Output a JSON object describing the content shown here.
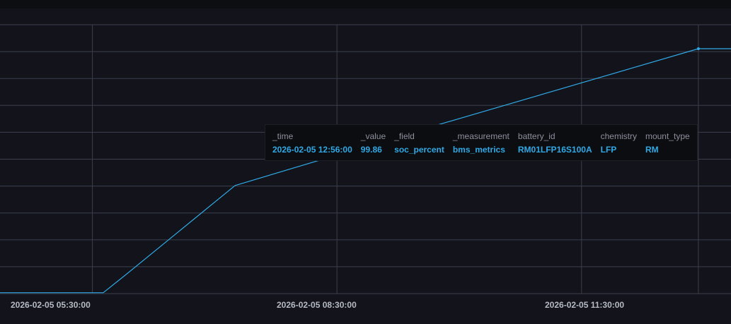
{
  "chart_data": {
    "type": "line",
    "series": [
      {
        "color": "#2fa9e6",
        "points": [
          [
            "2026-02-05 04:22:00",
            0
          ],
          [
            "2026-02-05 05:38:00",
            0
          ],
          [
            "2026-02-05 05:55:00",
            1.0
          ],
          [
            "2026-02-05 07:15:00",
            5.8
          ],
          [
            "2026-02-05 09:45:00",
            9.1
          ],
          [
            "2026-02-05 12:56:00",
            13.2
          ],
          [
            "2026-02-05 13:20:00",
            13.2
          ]
        ]
      }
    ],
    "x_range": [
      "2026-02-05 04:22:00",
      "2026-02-05 13:20:00"
    ],
    "y_range": [
      -0.05,
      14.5
    ],
    "x_tick_labels": [
      "2026-02-05 05:30:00",
      "2026-02-05 08:30:00",
      "2026-02-05 11:30:00"
    ],
    "grid": true,
    "highlighted_point": [
      "2026-02-05 12:56:00",
      13.2
    ]
  },
  "tooltip": {
    "columns": [
      {
        "header": "_time",
        "value": "2026-02-05 12:56:00"
      },
      {
        "header": "_value",
        "value": "99.86"
      },
      {
        "header": "_field",
        "value": "soc_percent"
      },
      {
        "header": "_measurement",
        "value": "bms_metrics"
      },
      {
        "header": "battery_id",
        "value": "RM01LFP16S100A"
      },
      {
        "header": "chemistry",
        "value": "LFP"
      },
      {
        "header": "mount_type",
        "value": "RM"
      }
    ]
  },
  "colors": {
    "background": "#13141b",
    "grid": "#3b3f4c",
    "line": "#2fa9e6",
    "tick_label": "#b6bac4"
  }
}
